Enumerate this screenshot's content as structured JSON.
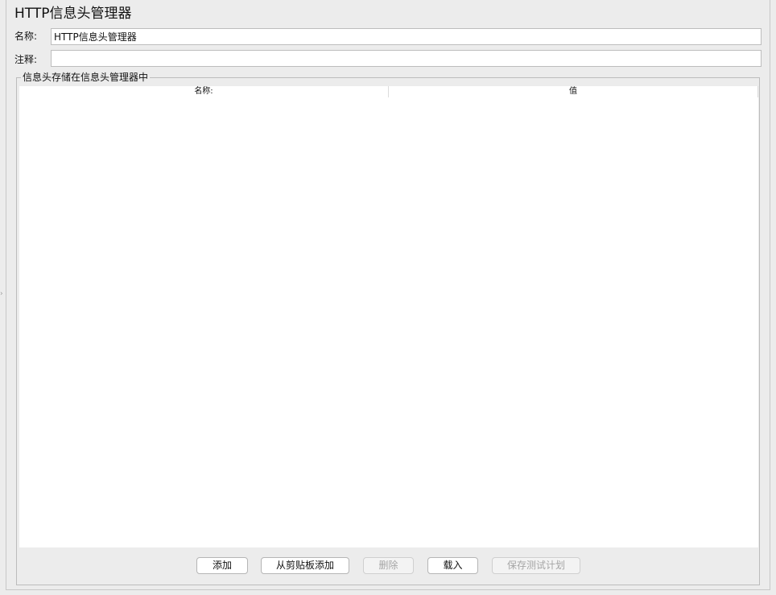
{
  "header": {
    "title": "HTTP信息头管理器"
  },
  "form": {
    "name_label": "名称:",
    "name_value": "HTTP信息头管理器",
    "comment_label": "注释:",
    "comment_value": ""
  },
  "group": {
    "legend": "信息头存储在信息头管理器中"
  },
  "table": {
    "columns": [
      "名称:",
      "值"
    ],
    "rows": []
  },
  "buttons": {
    "add": "添加",
    "add_from_clipboard": "从剪贴板添加",
    "delete": "删除",
    "load": "载入",
    "save_test_plan": "保存测试计划"
  }
}
